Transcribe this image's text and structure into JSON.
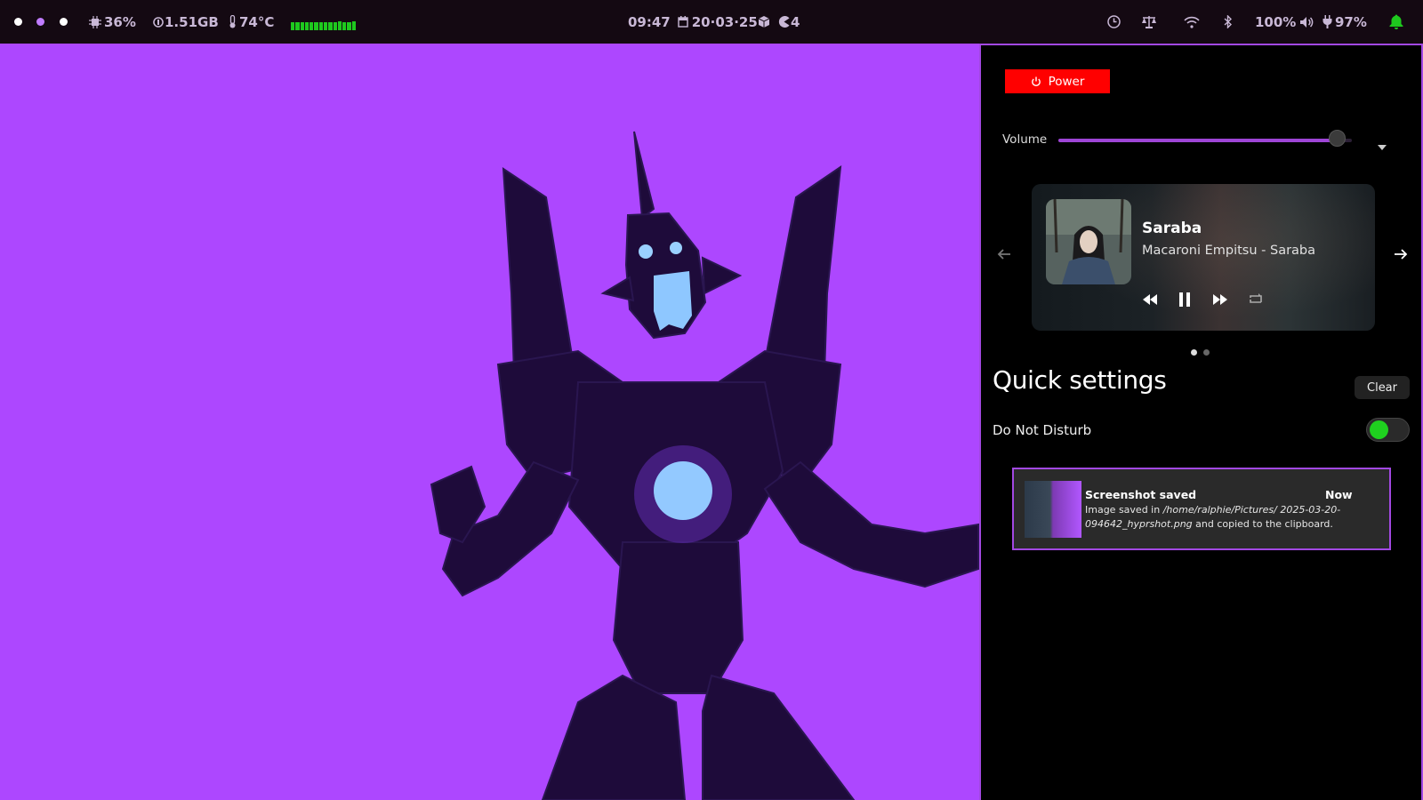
{
  "topbar": {
    "workspaces": [
      {
        "color": "#ffffff"
      },
      {
        "color": "#c07cff"
      },
      {
        "color": "#ffffff"
      }
    ],
    "cpu": "36%",
    "memory": "1.51GB",
    "temperature": "74°C",
    "time": "09:47",
    "date": "20·03·25",
    "pacman_count": "4",
    "volume": "100%",
    "battery": "97%",
    "icons": [
      "cpu-icon",
      "memory-icon",
      "thermometer-icon",
      "calendar-icon",
      "package-icon",
      "pacman-icon",
      "clock-icon",
      "scale-icon",
      "wifi-icon",
      "bluetooth-icon",
      "volume-icon",
      "plug-icon",
      "bell-icon"
    ],
    "accent_bell": "#1ec91e"
  },
  "panel": {
    "power_label": "Power",
    "volume_label": "Volume",
    "volume_level": 0.95,
    "player": {
      "title": "Saraba",
      "artist": "Macaroni Empitsu - Saraba"
    },
    "quick_settings_title": "Quick settings",
    "clear_label": "Clear",
    "dnd_label": "Do Not Disturb",
    "dnd_on": true,
    "notification": {
      "title": "Screenshot saved",
      "time": "Now",
      "body_prefix": "Image saved in ",
      "path": "/home/ralphie/Pictures/ 2025-03-20-094642_hyprshot.png",
      "body_suffix": " and copied to the clipboard."
    }
  },
  "colors": {
    "wallpaper": "#ad47ff",
    "panel_border": "#a248e2",
    "power_button": "#ff0000",
    "toggle_on": "#1fd11f"
  }
}
